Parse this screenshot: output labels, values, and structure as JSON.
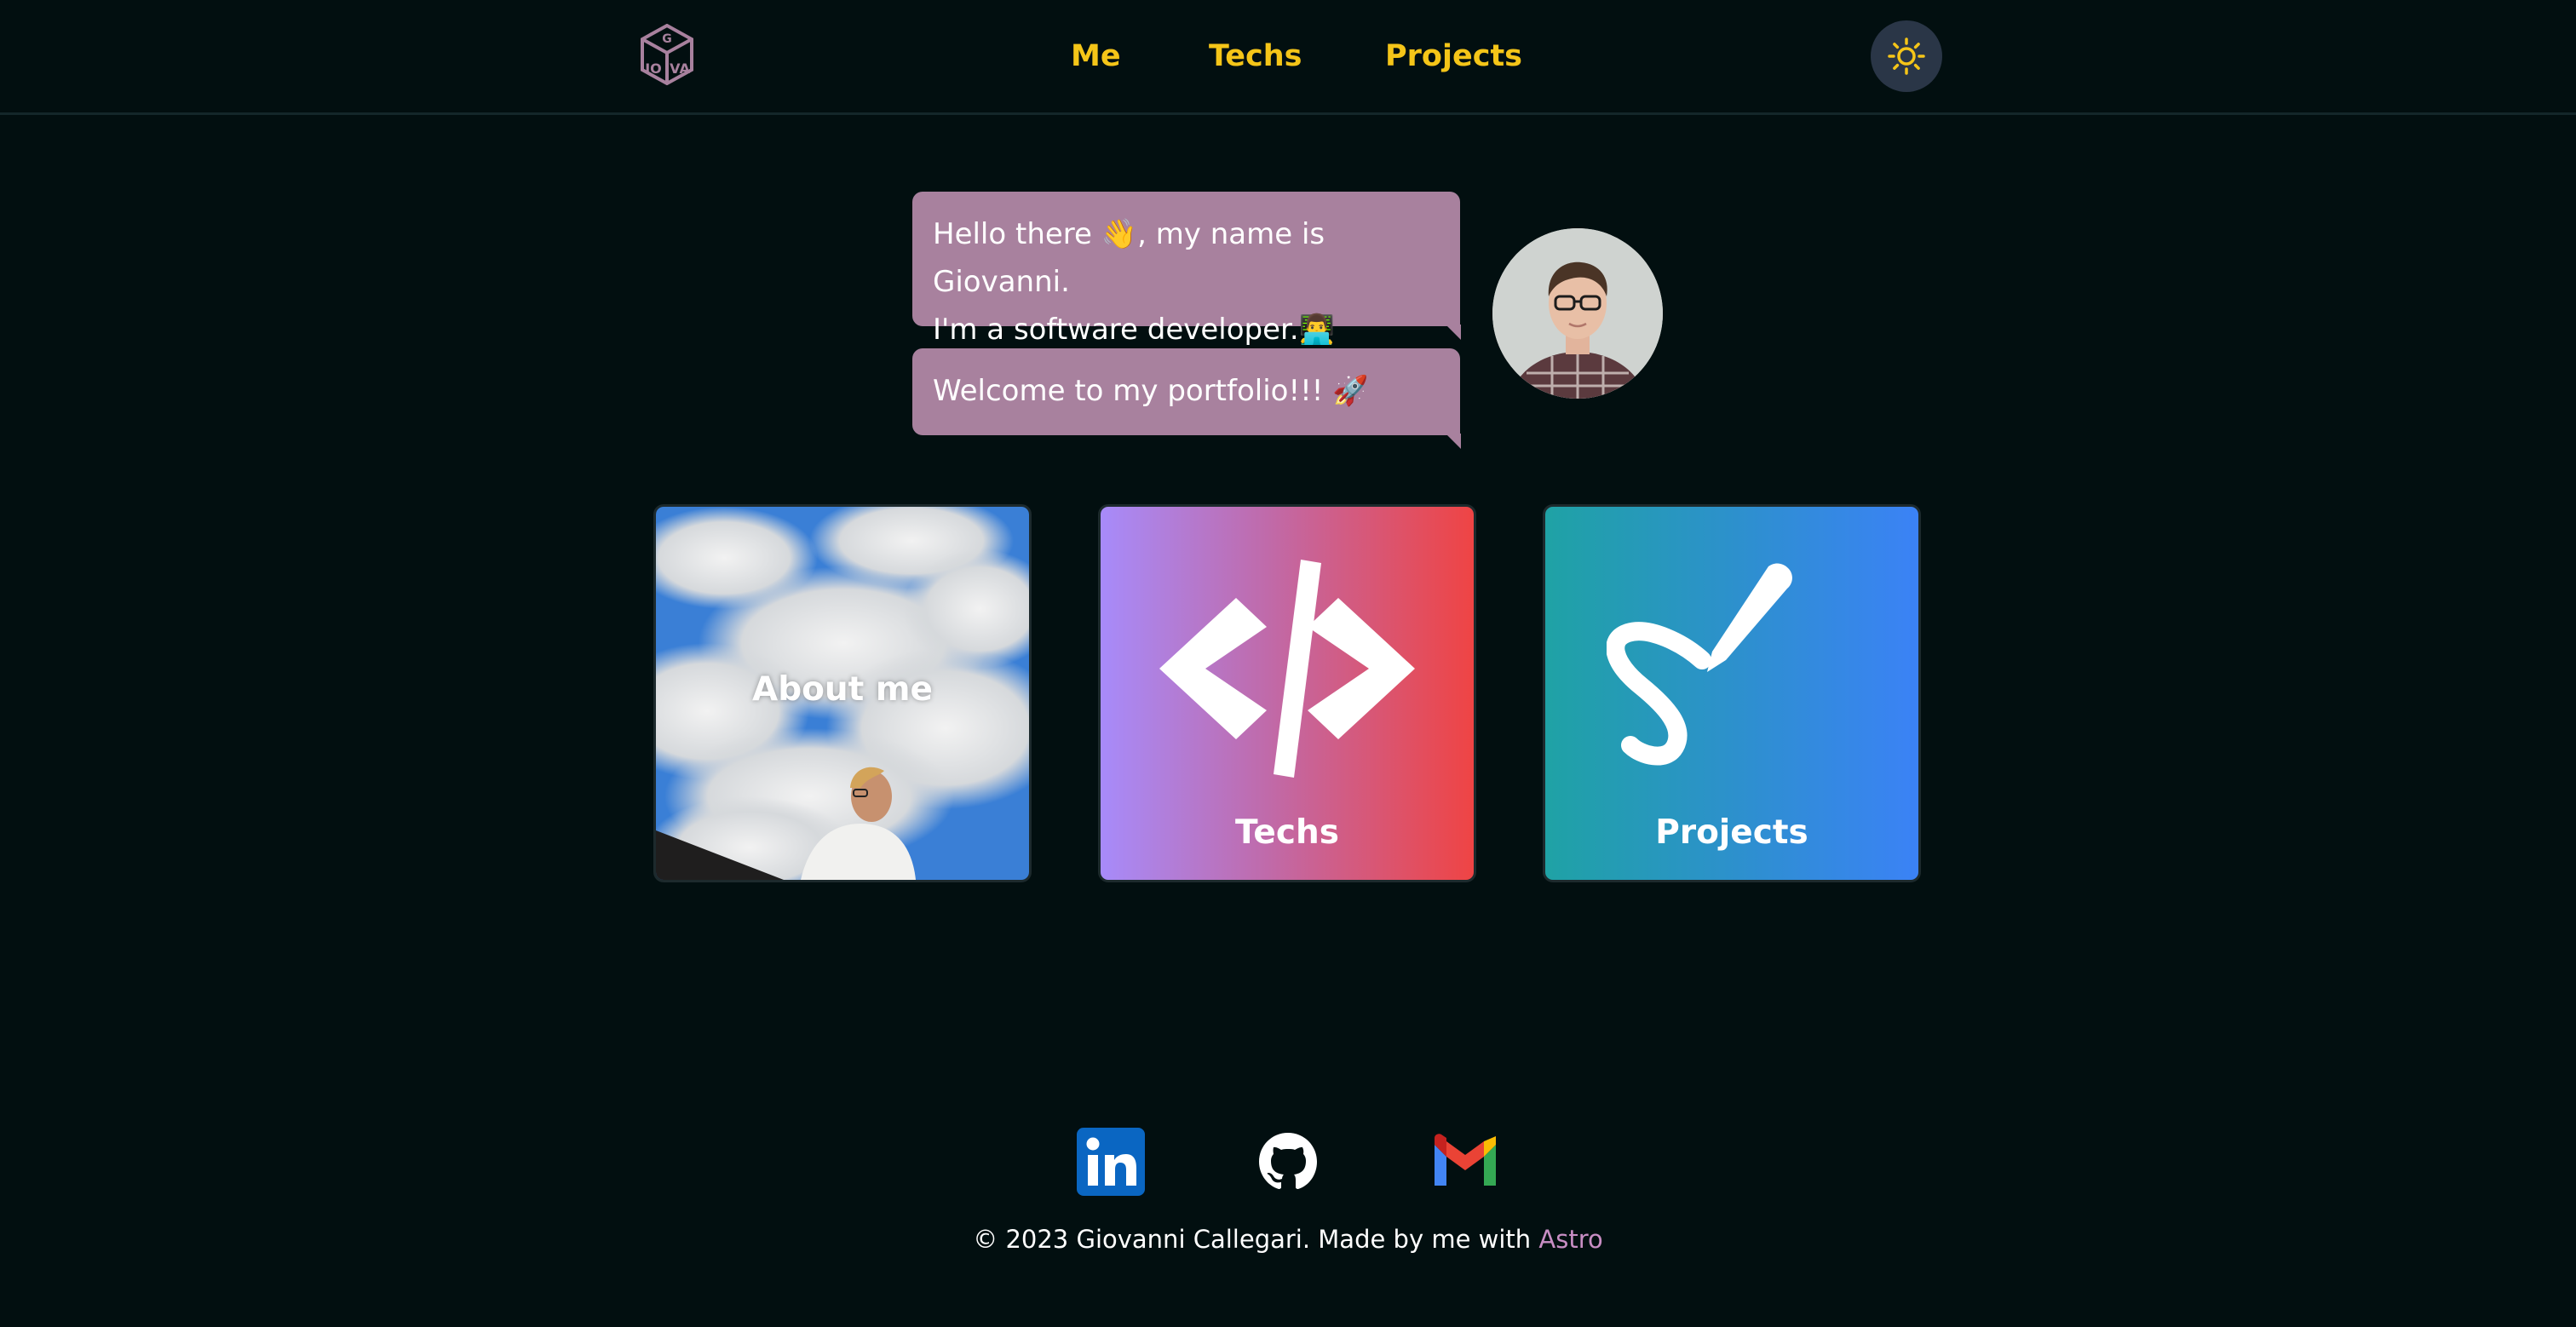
{
  "header": {
    "logo_text": "GIOVA",
    "nav": [
      {
        "label": "Me"
      },
      {
        "label": "Techs"
      },
      {
        "label": "Projects"
      }
    ],
    "theme_icon": "sun-icon"
  },
  "chat": {
    "message_1_line_1": "Hello there 👋, my name is Giovanni.",
    "message_1_line_2": "I'm a software developer.👨‍💻",
    "message_2": "Welcome to my portfolio!!! 🚀"
  },
  "cards": [
    {
      "label": "About me",
      "icon": "photo"
    },
    {
      "label": "Techs",
      "icon": "code-icon"
    },
    {
      "label": "Projects",
      "icon": "pencil-icon"
    }
  ],
  "footer": {
    "social": [
      {
        "name": "LinkedIn",
        "icon": "linkedin-icon",
        "color": "#0a66c2"
      },
      {
        "name": "GitHub",
        "icon": "github-icon",
        "color": "#ffffff"
      },
      {
        "name": "Gmail",
        "icon": "gmail-icon",
        "color": "#ea4335"
      }
    ],
    "copyright_prefix": "© 2023 Giovanni Callegari. Made by me with ",
    "copyright_link": "Astro"
  },
  "colors": {
    "background": "#020f10",
    "accent": "#f5c518",
    "bubble": "#a8819e"
  }
}
